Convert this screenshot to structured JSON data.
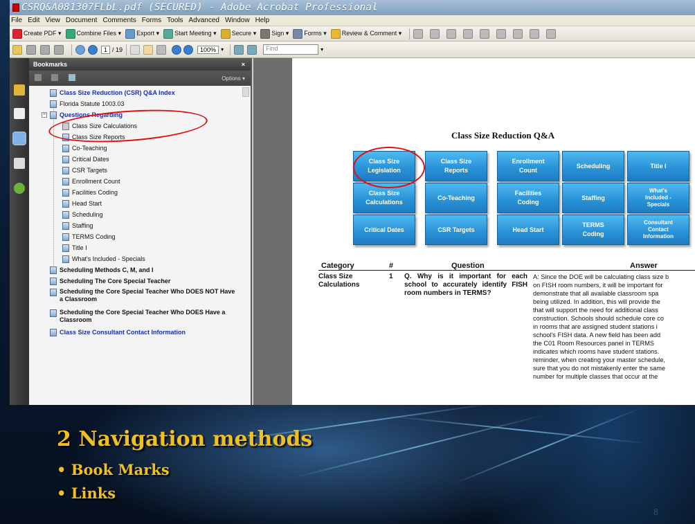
{
  "window": {
    "title": "CSRQ&A081307FLbL.pdf (SECURED) - Adobe Acrobat Professional"
  },
  "menu": [
    "File",
    "Edit",
    "View",
    "Document",
    "Comments",
    "Forms",
    "Tools",
    "Advanced",
    "Window",
    "Help"
  ],
  "toolbar1": {
    "create_pdf": "Create PDF ▾",
    "combine": "Combine Files ▾",
    "export": "Export ▾",
    "meeting": "Start Meeting ▾",
    "secure": "Secure ▾",
    "sign": "Sign ▾",
    "forms": "Forms ▾",
    "review": "Review & Comment ▾"
  },
  "toolbar2": {
    "page_current": "1",
    "page_total": "/ 19",
    "zoom": "100%",
    "find_placeholder": "Find"
  },
  "bookmarks": {
    "title": "Bookmarks",
    "close": "×",
    "options": "Options ▾",
    "items": [
      {
        "label": "Class Size Reduction (CSR) Q&A Index"
      },
      {
        "label": "Florida Statute 1003.03"
      },
      {
        "label": "Questions Regarding"
      },
      {
        "label": "Class Size Calculations"
      },
      {
        "label": "Class Size Reports"
      },
      {
        "label": "Co-Teaching"
      },
      {
        "label": "Critical Dates"
      },
      {
        "label": "CSR Targets"
      },
      {
        "label": "Enrollment Count"
      },
      {
        "label": "Facilities Coding"
      },
      {
        "label": "Head Start"
      },
      {
        "label": "Scheduling"
      },
      {
        "label": "Staffing"
      },
      {
        "label": "TERMS Coding"
      },
      {
        "label": "Title I"
      },
      {
        "label": "What's Included - Specials"
      },
      {
        "label": "Scheduling Methods C, M, and I"
      },
      {
        "label": "Scheduling The Core Special Teacher"
      },
      {
        "label": "Scheduling the Core Special Teacher Who DOES NOT Have a Classroom"
      },
      {
        "label": "Scheduling the Core Special Teacher Who DOES Have a Classroom"
      },
      {
        "label": "Class Size Consultant Contact Information"
      }
    ]
  },
  "document": {
    "title": "Class Size Reduction Q&A",
    "buttons": [
      [
        "Class Size",
        "Legislation"
      ],
      [
        "Class Size",
        "Reports"
      ],
      [
        "Enrollment",
        "Count"
      ],
      [
        "Scheduling"
      ],
      [
        "Title I"
      ],
      [
        "Class Size",
        "Calculations"
      ],
      [
        "Co-Teaching"
      ],
      [
        "Facilities",
        "Coding"
      ],
      [
        "Staffing"
      ],
      [
        "What's",
        "Included -",
        "Specials"
      ],
      [
        "Critical Dates"
      ],
      [
        "CSR Targets"
      ],
      [
        "Head Start"
      ],
      [
        "TERMS",
        "Coding"
      ],
      [
        "Consultant",
        "Contact",
        "Information"
      ]
    ],
    "table": {
      "headers": {
        "category": "Category",
        "num": "#",
        "question": "Question",
        "answer": "Answer"
      },
      "row": {
        "category": "Class Size Calculations",
        "num": "1",
        "question": "Q. Why is it important for each school to accurately identify FISH room numbers in TERMS?",
        "answer_lines": [
          "A: Since the DOE will be calculating class size b",
          "on FISH room numbers, it will be important for",
          "demonstrate that all available classroom spa",
          "being utilized. In addition, this will provide the",
          "that will support the need for additional class",
          "construction. Schools should schedule core co",
          "in rooms that are assigned student stations i",
          "school's FISH data. A new field has been add",
          "the C01 Room Resources panel in TERMS",
          "indicates which rooms have student stations.",
          "reminder, when creating your master schedule,",
          "sure that you do not mistakenly enter the same",
          "number for multiple classes that occur at the"
        ]
      }
    }
  },
  "slide": {
    "heading": "2 Navigation methods",
    "bullets": [
      "• Book Marks",
      "• Links"
    ],
    "page_number": "8"
  }
}
